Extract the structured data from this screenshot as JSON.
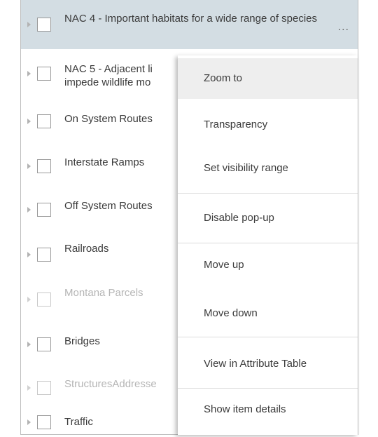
{
  "layers": [
    {
      "label": "NAC 4 - Important habitats for a wide range of species",
      "enabled": true,
      "selected": true
    },
    {
      "label": "NAC 5 - Adjacent li impede wildlife mo",
      "line1": "NAC 5 - Adjacent li",
      "line2": "impede wildlife mo",
      "enabled": true
    },
    {
      "label": "On System Routes",
      "enabled": true
    },
    {
      "label": "Interstate Ramps",
      "enabled": true
    },
    {
      "label": "Off System Routes",
      "enabled": true
    },
    {
      "label": "Railroads",
      "enabled": true
    },
    {
      "label": "Montana Parcels",
      "enabled": false
    },
    {
      "label": "Bridges",
      "enabled": true
    },
    {
      "label": "StructuresAddresse",
      "enabled": false
    },
    {
      "label": "Traffic",
      "enabled": true
    }
  ],
  "more_options_label": "...",
  "menu": {
    "items": [
      {
        "label": "Zoom to"
      },
      {
        "label": "Transparency"
      },
      {
        "label": "Set visibility range"
      },
      {
        "label": "Disable pop-up"
      },
      {
        "label": "Move up"
      },
      {
        "label": "Move down"
      },
      {
        "label": "View in Attribute Table"
      },
      {
        "label": "Show item details"
      }
    ]
  },
  "colors": {
    "selected_row": "#d3dde3",
    "menu_hover": "#eeeeee",
    "disabled_text": "#b5b5b5"
  }
}
